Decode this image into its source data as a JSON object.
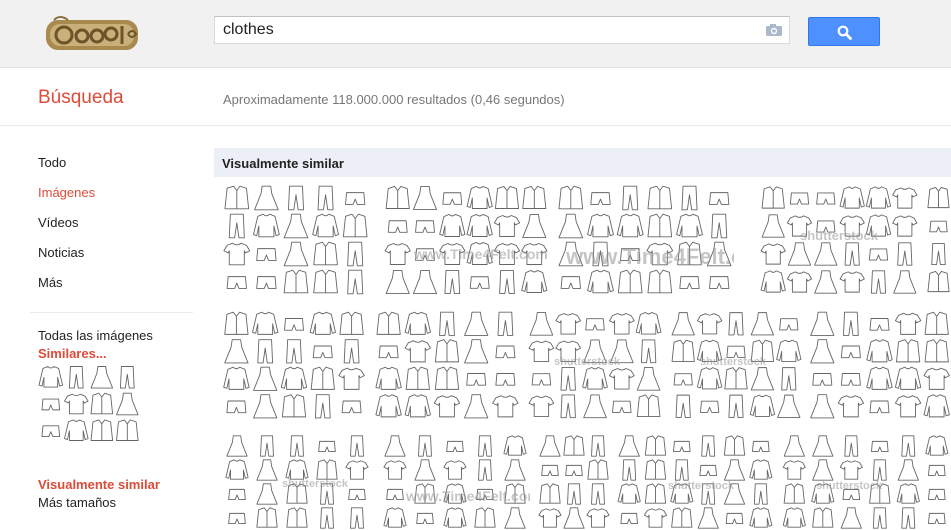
{
  "search": {
    "query": "clothes"
  },
  "header": {
    "section_title": "Búsqueda",
    "result_stats": "Aproximadamente 118.000.000 resultados (0,46 segundos)"
  },
  "nav": {
    "items": [
      {
        "label": "Todo",
        "active": false
      },
      {
        "label": "Imágenes",
        "active": true
      },
      {
        "label": "Vídeos",
        "active": false
      },
      {
        "label": "Noticias",
        "active": false
      },
      {
        "label": "Más",
        "active": false
      }
    ]
  },
  "sidebar": {
    "all_images": "Todas las imágenes",
    "similar": "Similares...",
    "visually_similar": "Visualmente similar",
    "more_sizes": "Más tamaños"
  },
  "results": {
    "section_label": "Visualmente similar",
    "watermarks": {
      "time4felt": "www.Time4Felt.com",
      "shutterstock": "shutterstock"
    }
  },
  "colors": {
    "accent_red": "#dd4b39",
    "search_blue": "#4d90fe",
    "section_bg": "#eceff6"
  }
}
